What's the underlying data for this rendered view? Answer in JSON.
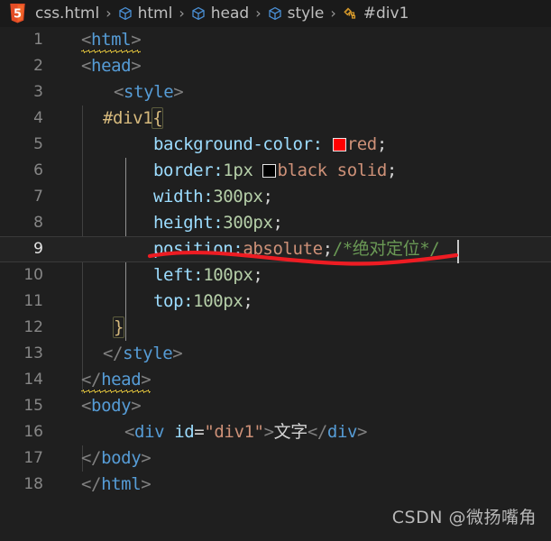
{
  "breadcrumb": {
    "file_icon": "html5-icon",
    "separator": "›",
    "segments": [
      {
        "label": "css.html",
        "icon": ""
      },
      {
        "label": "html",
        "icon": "symbol-cube-icon"
      },
      {
        "label": "head",
        "icon": "symbol-cube-icon"
      },
      {
        "label": "style",
        "icon": "symbol-cube-icon"
      },
      {
        "label": "#div1",
        "icon": "symbol-ruler-icon"
      }
    ]
  },
  "editor": {
    "active_line": 9,
    "cursor": {
      "line": 9,
      "column": 29
    },
    "lines": [
      {
        "n": "1",
        "text": "<html>"
      },
      {
        "n": "2",
        "text": "<head>"
      },
      {
        "n": "3",
        "text": "  <style>"
      },
      {
        "n": "4",
        "text": "  #div1{"
      },
      {
        "n": "5",
        "text": "      background-color: red;"
      },
      {
        "n": "6",
        "text": "      border:1px black solid;"
      },
      {
        "n": "7",
        "text": "      width:300px;"
      },
      {
        "n": "8",
        "text": "      height:300px;"
      },
      {
        "n": "9",
        "text": "      position:absolute;/*绝对定位*/"
      },
      {
        "n": "10",
        "text": "      left:100px;"
      },
      {
        "n": "11",
        "text": "      top:100px;"
      },
      {
        "n": "12",
        "text": "  }"
      },
      {
        "n": "13",
        "text": "  </style>"
      },
      {
        "n": "14",
        "text": "</head>"
      },
      {
        "n": "15",
        "text": "<body>"
      },
      {
        "n": "16",
        "text": "    <div id=\"div1\">文字</div>"
      },
      {
        "n": "17",
        "text": "</body>"
      },
      {
        "n": "18",
        "text": "</html>"
      }
    ],
    "tokens": {
      "l1_open": "<",
      "l1_tag": "html",
      "l1_close": ">",
      "l2_open": "<",
      "l2_tag": "head",
      "l2_close": ">",
      "l3_open": "<",
      "l3_tag": "style",
      "l3_close": ">",
      "l4_sel": "#div1",
      "l4_brace": "{",
      "l5_prop": "background-color:",
      "l5_val": "red",
      "l5_semi": ";",
      "l6_prop": "border:",
      "l6_num": "1px",
      "l6_val": "black solid",
      "l6_semi": ";",
      "l7_prop": "width:",
      "l7_num": "300px",
      "l7_semi": ";",
      "l8_prop": "height:",
      "l8_num": "300px",
      "l8_semi": ";",
      "l9_prop": "position:",
      "l9_val": "absolute",
      "l9_semi": ";",
      "l9_comment": "/*绝对定位*/",
      "l10_prop": "left:",
      "l10_num": "100px",
      "l10_semi": ";",
      "l11_prop": "top:",
      "l11_num": "100px",
      "l11_semi": ";",
      "l12_brace": "}",
      "l13_open": "</",
      "l13_tag": "style",
      "l13_close": ">",
      "l14_open": "</",
      "l14_tag": "head",
      "l14_close": ">",
      "l15_open": "<",
      "l15_tag": "body",
      "l15_close": ">",
      "l16_open": "<",
      "l16_tag": "div",
      "l16_space": " ",
      "l16_attr": "id",
      "l16_eq": "=",
      "l16_str": "\"div1\"",
      "l16_gt": ">",
      "l16_text": "文字",
      "l16_open2": "</",
      "l16_tag2": "div",
      "l16_close2": ">",
      "l17_open": "</",
      "l17_tag": "body",
      "l17_close": ">",
      "l18_open": "</",
      "l18_tag": "html",
      "l18_close": ">"
    },
    "swatches": {
      "background_color": "#ff0000",
      "border_color": "#000000"
    }
  },
  "annotation": {
    "name": "red-underline",
    "color": "#ee1c23",
    "target_line": 9
  },
  "watermark": {
    "text": "CSDN @微扬嘴角"
  },
  "theme": {
    "editor_background": "#1f1f1f",
    "breadcrumb_background": "#1a1a1a",
    "current_line_background": "#232323",
    "tag_color": "#569cd6",
    "property_color": "#9cdcfe",
    "value_color": "#ce9178",
    "number_color": "#b5cea8",
    "comment_color": "#6a9955",
    "selector_color": "#d7ba7d",
    "line_number_color": "#868686",
    "punctuation_color": "#808080"
  }
}
